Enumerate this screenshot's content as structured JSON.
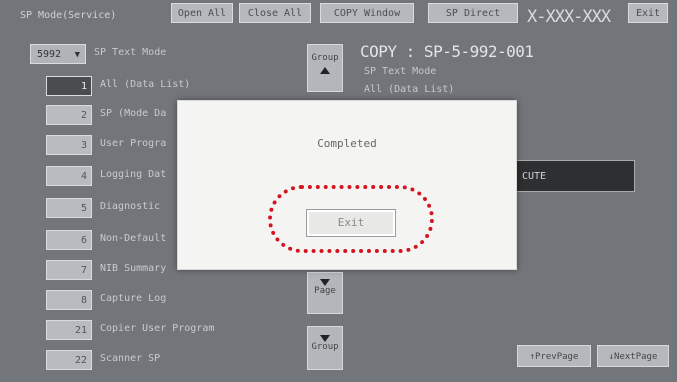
{
  "topbar": {
    "mode_label": "SP Mode(Service)",
    "open_all": "Open All",
    "close_all": "Close All",
    "copy_window": "COPY Window",
    "sp_direct": "SP Direct",
    "model": "X-XXX-XXX",
    "exit": "Exit"
  },
  "left": {
    "selector_value": "5992",
    "selector_arrow": "▼",
    "title": "SP Text Mode",
    "items": [
      {
        "num": "1",
        "label": "All (Data List)"
      },
      {
        "num": "2",
        "label": "SP (Mode Da"
      },
      {
        "num": "3",
        "label": "User Progra"
      },
      {
        "num": "4",
        "label": "Logging Dat"
      },
      {
        "num": "5",
        "label": "Diagnostic"
      },
      {
        "num": "6",
        "label": "Non-Default"
      },
      {
        "num": "7",
        "label": "NIB Summary"
      },
      {
        "num": "8",
        "label": "Capture Log"
      },
      {
        "num": "21",
        "label": "Copier User Program"
      },
      {
        "num": "22",
        "label": "Scanner SP"
      }
    ]
  },
  "group": {
    "top_label": "Group",
    "page_label": "Page",
    "bottom_label": "Group"
  },
  "right": {
    "title": "COPY : SP-5-992-001",
    "sub1": "SP Text Mode",
    "sub2": "All (Data List)",
    "execute_partial": "CUTE",
    "prev_page": "↑PrevPage",
    "next_page": "↓NextPage"
  },
  "dialog": {
    "message": "Completed",
    "exit_label": "Exit",
    "highlight_color": "#d4141e"
  }
}
